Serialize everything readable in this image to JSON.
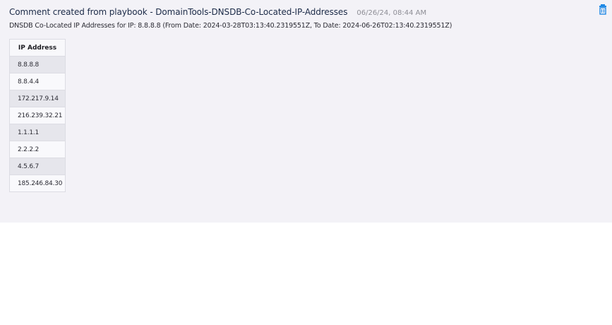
{
  "comment": {
    "title": "Comment created from playbook - DomainTools-DNSDB-Co-Located-IP-Addresses",
    "timestamp": "06/26/24, 08:44 AM",
    "description": "DNSDB Co-Located IP Addresses for IP: 8.8.8.8 (From Date: 2024-03-28T03:13:40.2319551Z, To Date: 2024-06-26T02:13:40.2319551Z)",
    "delete_icon": "trash-icon",
    "accent_color": "#1e88e5"
  },
  "table": {
    "columns": [
      "IP Address"
    ],
    "rows": [
      "8.8.8.8",
      "8.8.4.4",
      "172.217.9.14",
      "216.239.32.21",
      "1.1.1.1",
      "2.2.2.2",
      "4.5.6.7",
      "185.246.84.30"
    ]
  }
}
